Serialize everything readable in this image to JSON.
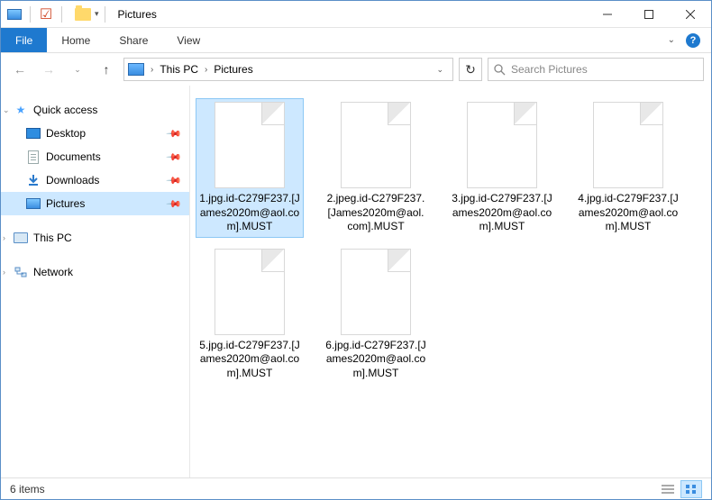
{
  "titlebar": {
    "title": "Pictures"
  },
  "ribbon": {
    "file": "File",
    "tabs": [
      "Home",
      "Share",
      "View"
    ]
  },
  "address": {
    "crumbs": [
      "This PC",
      "Pictures"
    ]
  },
  "search": {
    "placeholder": "Search Pictures"
  },
  "sidebar": {
    "quick_access": "Quick access",
    "items": [
      {
        "label": "Desktop",
        "icon": "desktop"
      },
      {
        "label": "Documents",
        "icon": "doc"
      },
      {
        "label": "Downloads",
        "icon": "down"
      },
      {
        "label": "Pictures",
        "icon": "pic",
        "selected": true
      }
    ],
    "this_pc": "This PC",
    "network": "Network"
  },
  "files": [
    {
      "name": "1.jpg.id-C279F237.[James2020m@aol.com].MUST",
      "selected": true
    },
    {
      "name": "2.jpeg.id-C279F237.[James2020m@aol.com].MUST"
    },
    {
      "name": "3.jpg.id-C279F237.[James2020m@aol.com].MUST"
    },
    {
      "name": "4.jpg.id-C279F237.[James2020m@aol.com].MUST"
    },
    {
      "name": "5.jpg.id-C279F237.[James2020m@aol.com].MUST"
    },
    {
      "name": "6.jpg.id-C279F237.[James2020m@aol.com].MUST"
    }
  ],
  "statusbar": {
    "count": "6 items"
  }
}
